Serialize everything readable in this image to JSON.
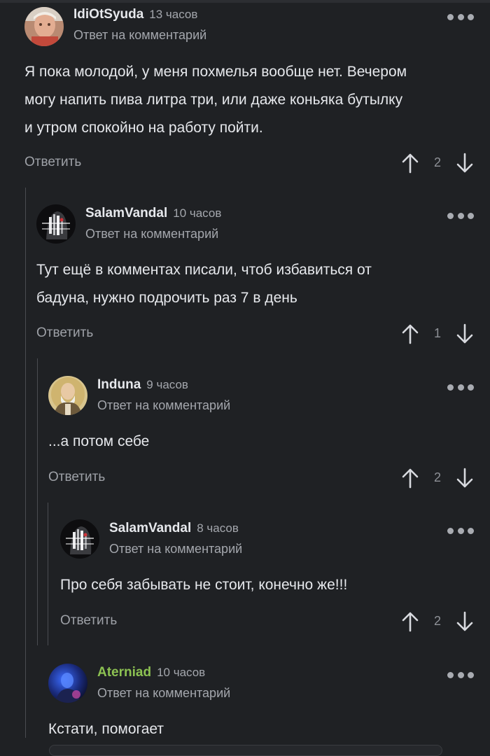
{
  "comments": [
    {
      "author": "IdiOtSyuda",
      "time": "13 часов",
      "reply_to": "Ответ на комментарий",
      "lines": [
        "Я пока молодой, у меня похмелья вообще нет. Вечером",
        "могу напить пива литра три, или даже коньяка бутылку",
        "и утром спокойно на работу пойти."
      ],
      "reply_label": "Ответить",
      "votes": "2"
    },
    {
      "author": "SalamVandal",
      "time": "10 часов",
      "reply_to": "Ответ на комментарий",
      "lines": [
        "Тут ещё в комментах писали, чтоб избавиться от",
        "бадуна, нужно подрочить раз 7 в день"
      ],
      "reply_label": "Ответить",
      "votes": "1"
    },
    {
      "author": "Induna",
      "time": "9 часов",
      "reply_to": "Ответ на комментарий",
      "lines": [
        "...а потом себе"
      ],
      "reply_label": "Ответить",
      "votes": "2"
    },
    {
      "author": "SalamVandal",
      "time": "8 часов",
      "reply_to": "Ответ на комментарий",
      "lines": [
        "Про себя забывать не стоит, конечно же!!!"
      ],
      "reply_label": "Ответить",
      "votes": "2"
    },
    {
      "author": "Aterniad",
      "time": "10 часов",
      "reply_to": "Ответ на комментарий",
      "lines": [
        "Кстати, помогает"
      ]
    }
  ],
  "icons": {
    "more": "more-dots-icon",
    "upvote": "arrow-up-icon",
    "downvote": "arrow-down-icon"
  },
  "colors": {
    "background": "#1f2124",
    "text": "#e6e8ec",
    "muted": "#a4a7ad",
    "highlight_author": "#8cc152"
  }
}
